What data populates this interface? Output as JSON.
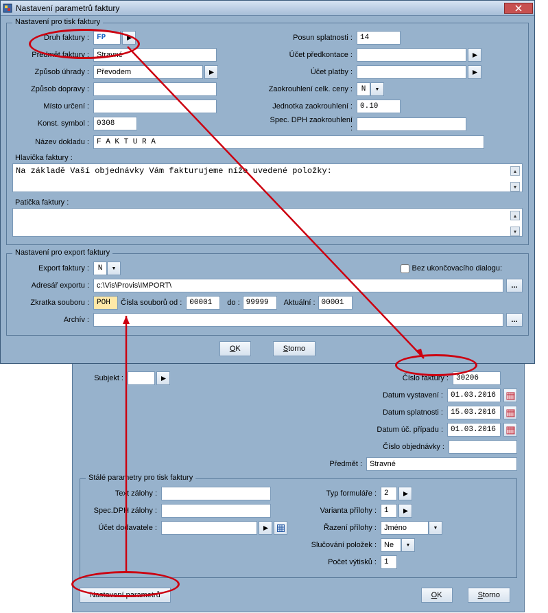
{
  "window_title": "Nastavení parametrů faktury",
  "group_print": {
    "title": "Nastavení pro tisk faktury",
    "labels": {
      "druh_faktury": "Druh faktury :",
      "predmet_faktury": "Předmět faktury :",
      "zpusob_uhrady": "Způsob úhrady :",
      "zpusob_dopravy": "Způsob dopravy :",
      "misto_urceni": "Místo určení :",
      "konst_symbol": "Konst. symbol :",
      "nazev_dokladu": "Název dokladu :",
      "hlavicka": "Hlavička faktury :",
      "paticka": "Patička faktury :",
      "posun": "Posun splatnosti :",
      "ucet_predk": "Účet předkontace :",
      "ucet_platby": "Účet platby :",
      "zaok_celk": "Zaokrouhlení celk. ceny :",
      "jednotka_zaok": "Jednotka zaokrouhlení :",
      "spec_dph_zaok": "Spec. DPH zaokrouhlení :"
    },
    "values": {
      "druh_faktury": "FP",
      "predmet_faktury": "Stravné",
      "zpusob_uhrady": "Převodem",
      "zpusob_dopravy": "",
      "misto_urceni": "",
      "konst_symbol": "0308",
      "nazev_dokladu": "F A K T U R A",
      "posun": "14",
      "ucet_predk": "",
      "ucet_platby": "",
      "zaok_celk": "N",
      "jednotka_zaok": "0.10",
      "spec_dph_zaok": "",
      "hlavicka_text": "Na základě Vaší objednávky Vám fakturujeme níže uvedené položky:",
      "paticka_text": ""
    }
  },
  "group_export": {
    "title": "Nastavení pro export faktury",
    "labels": {
      "export_faktury": "Export faktury :",
      "adresar": "Adresář exportu :",
      "zkratka": "Zkratka souboru :",
      "cisla_od": "Čísla souborů od :",
      "do": "do :",
      "aktualni": "Aktuální :",
      "archiv": "Archív :",
      "bez_dialogu": "Bez ukončovacího dialogu:"
    },
    "values": {
      "export_faktury": "N",
      "adresar": "c:\\Vis\\Provis\\IMPORT\\",
      "zkratka": "POH",
      "od_val": "00001",
      "do_val": "99999",
      "aktualni_val": "00001",
      "archiv": ""
    }
  },
  "buttons": {
    "ok": "OK",
    "ok_u": "O",
    "storno": "Storno",
    "storno_u": "S",
    "nastaveni": "Nastavení parametrů"
  },
  "lower": {
    "labels": {
      "subjekt": "Subjekt :",
      "cislo_fakt": "Číslo faktury :",
      "datum_vys": "Datum vystavení :",
      "datum_spl": "Datum splatnosti :",
      "datum_uc": "Datum úč. případu :",
      "cislo_obj": "Číslo objednávky :",
      "predmet": "Předmět :"
    },
    "values": {
      "subjekt": "",
      "cislo_fakt": "30206",
      "datum_vys": "01.03.2016",
      "datum_spl": "15.03.2016",
      "datum_uc": "01.03.2016",
      "cislo_obj": "",
      "predmet": "Stravné"
    },
    "group_stale": {
      "title": "Stálé parametry pro tisk faktury",
      "labels": {
        "text_zalohy": "Text zálohy :",
        "spec_dph": "Spec.DPH zálohy :",
        "ucet_dod": "Účet dodavatele :",
        "typ_form": "Typ formuláře :",
        "var_pril": "Varianta přílohy :",
        "razeni": "Řazení přílohy :",
        "slucovani": "Slučování položek :",
        "pocet_vyt": "Počet výtisků :"
      },
      "values": {
        "text_zalohy": "",
        "spec_dph": "",
        "ucet_dod": "",
        "typ_form": "2",
        "var_pril": "1",
        "razeni": "Jméno",
        "slucovani": "Ne",
        "pocet_vyt": "1"
      }
    }
  }
}
